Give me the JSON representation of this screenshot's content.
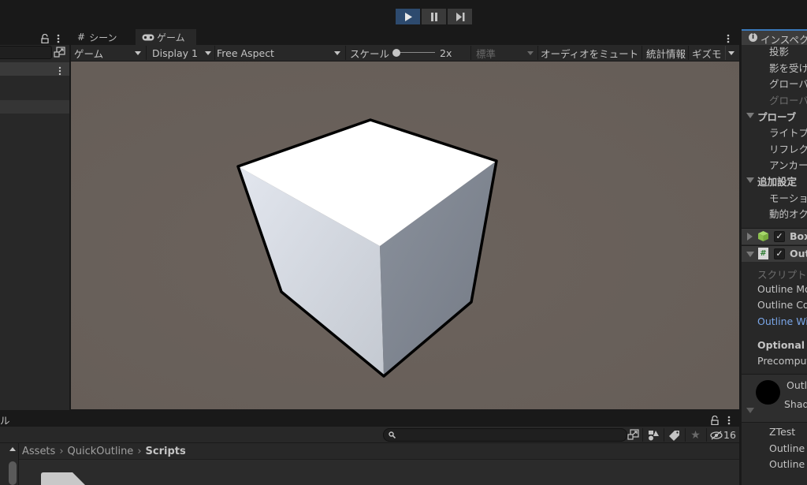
{
  "toolbar": {
    "play_state": "playing",
    "buttons": [
      {
        "name": "play",
        "icon": "play-icon",
        "active": true
      },
      {
        "name": "pause",
        "icon": "pause-icon",
        "active": false
      },
      {
        "name": "step",
        "icon": "step-icon",
        "active": false
      }
    ]
  },
  "hierarchy": {
    "lock_icon": "lock-icon",
    "menu_icon": "kebab-menu-icon",
    "search_value": "",
    "search_button_icon": "search-popout-icon"
  },
  "game_view": {
    "tabs": [
      {
        "label": "シーン",
        "icon": "hash-icon",
        "active": false
      },
      {
        "label": "ゲーム",
        "icon": "gamepad-icon",
        "active": true
      }
    ],
    "toolbar": {
      "view_mode": "ゲーム",
      "display": "Display 1",
      "aspect": "Free Aspect",
      "scale_label": "スケール",
      "scale_value": "2x",
      "scale_fraction": 0.0,
      "quality": "標準",
      "mute_audio": "オーディオをミュート",
      "stats": "統計情報",
      "gizmos": "ギズモ"
    },
    "background_color": "#6a615b",
    "object": {
      "name": "cube",
      "outline_color": "#000000",
      "face_color": "#ffffff"
    }
  },
  "inspector": {
    "title": "インスペクター",
    "rows": [
      {
        "label": "投影",
        "style": "normal",
        "indent": 2
      },
      {
        "label": "影を受ける",
        "style": "normal",
        "indent": 2
      },
      {
        "label": "グローバルイルミネーション",
        "style": "normal",
        "indent": 2
      },
      {
        "label": "グローバルイルミネーション",
        "style": "dim",
        "indent": 2
      },
      {
        "label": "プローブ",
        "style": "bold",
        "indent": 1,
        "expanded": true
      },
      {
        "label": "ライトプローブ",
        "style": "normal",
        "indent": 2
      },
      {
        "label": "リフレクションプローブ",
        "style": "normal",
        "indent": 2
      },
      {
        "label": "アンカーオーバーライド",
        "style": "normal",
        "indent": 2
      },
      {
        "label": "追加設定",
        "style": "bold",
        "indent": 1,
        "expanded": true
      },
      {
        "label": "モーションベクトル",
        "style": "normal",
        "indent": 2
      },
      {
        "label": "動的オクルージョン",
        "style": "normal",
        "indent": 2
      }
    ],
    "components": [
      {
        "name": "Box Collider",
        "icon": "box-collider-icon",
        "enabled": true,
        "expanded": false
      },
      {
        "name": "Outline",
        "icon": "script-icon",
        "enabled": true,
        "expanded": true
      }
    ],
    "outline_fields": [
      {
        "label": "スクリプト",
        "style": "dim"
      },
      {
        "label": "Outline Mode",
        "style": "normal"
      },
      {
        "label": "Outline Color",
        "style": "normal"
      },
      {
        "label": "Outline Width",
        "style": "blue"
      },
      {
        "label": "Optional",
        "style": "bold"
      },
      {
        "label": "Precompute Outline",
        "style": "normal"
      }
    ],
    "material": {
      "name": "Outline",
      "shader_label": "Shader",
      "swatch_color": "#000000"
    },
    "material_fields": [
      {
        "label": "ZTest"
      },
      {
        "label": "Outline Color"
      },
      {
        "label": "Outline Width"
      }
    ]
  },
  "project": {
    "tab_label": "ル",
    "search_value": "",
    "hidden_count": "16",
    "breadcrumb": [
      "Assets",
      "QuickOutline",
      "Scripts"
    ]
  }
}
